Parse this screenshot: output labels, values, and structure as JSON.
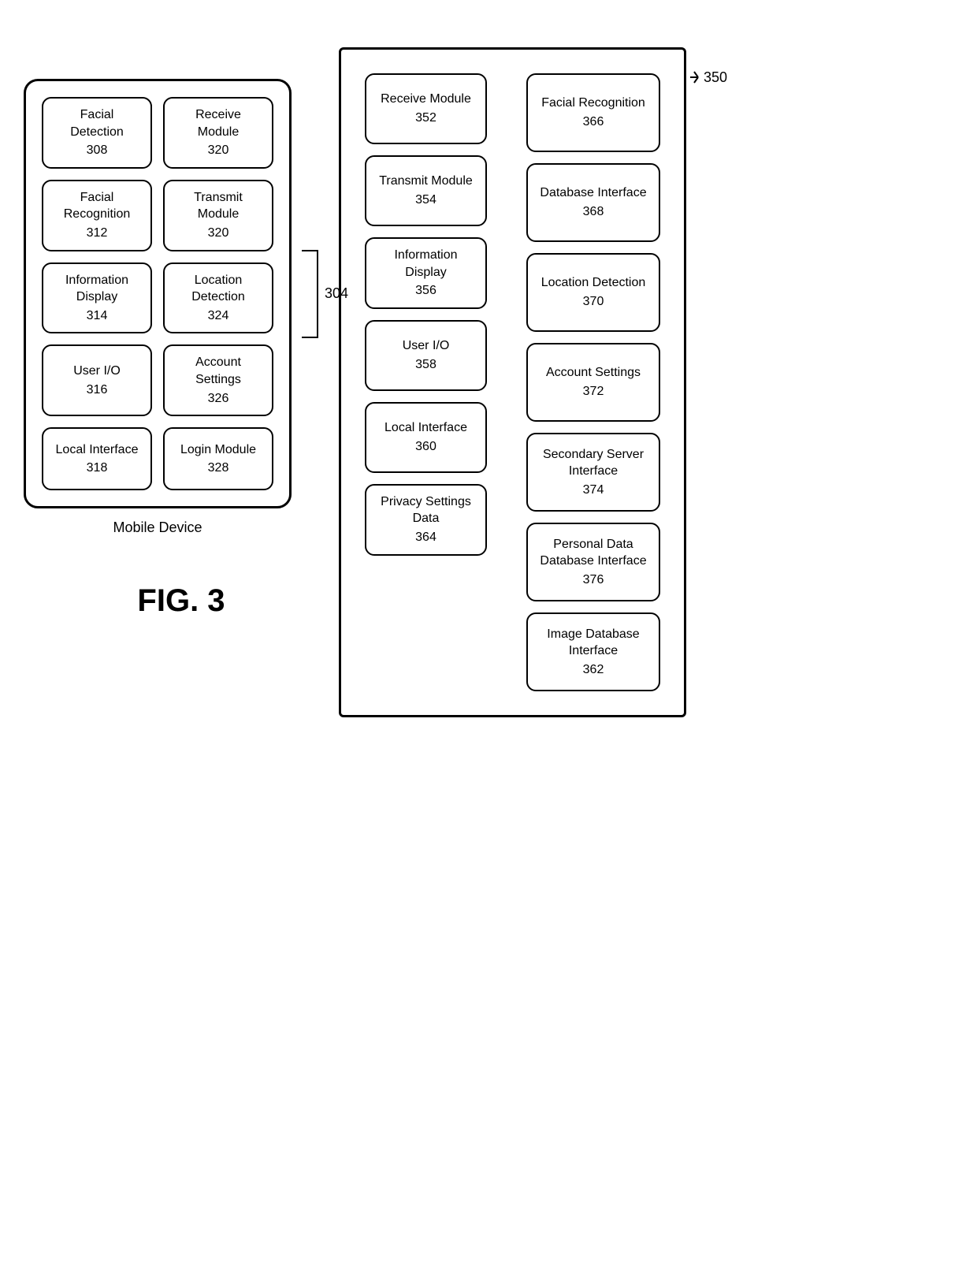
{
  "left": {
    "title": "Mobile Device",
    "box_label": "304",
    "fig": "FIG. 3",
    "modules": [
      {
        "name": "Facial Detection",
        "number": "308"
      },
      {
        "name": "Receive Module",
        "number": "320"
      },
      {
        "name": "Facial Recognition",
        "number": "312"
      },
      {
        "name": "Transmit Module",
        "number": "320"
      },
      {
        "name": "Information Display",
        "number": "314"
      },
      {
        "name": "Location Detection",
        "number": "324"
      },
      {
        "name": "User I/O",
        "number": "316"
      },
      {
        "name": "Account Settings",
        "number": "326"
      },
      {
        "name": "Local Interface",
        "number": "318"
      },
      {
        "name": "Login Module",
        "number": "328"
      }
    ]
  },
  "right": {
    "box_label": "350",
    "center_modules": [
      {
        "name": "Receive Module",
        "number": "352"
      },
      {
        "name": "Transmit Module",
        "number": "354"
      },
      {
        "name": "Information Display",
        "number": "356"
      },
      {
        "name": "User I/O",
        "number": "358"
      },
      {
        "name": "Local Interface",
        "number": "360"
      },
      {
        "name": "Privacy Settings Data",
        "number": "364"
      }
    ],
    "right_modules": [
      {
        "name": "Facial Recognition",
        "number": "366"
      },
      {
        "name": "Database Interface",
        "number": "368"
      },
      {
        "name": "Location Detection",
        "number": "370"
      },
      {
        "name": "Account Settings",
        "number": "372"
      },
      {
        "name": "Secondary Server Interface",
        "number": "374"
      },
      {
        "name": "Personal Data Database Interface",
        "number": "376"
      },
      {
        "name": "Image Database Interface",
        "number": "362"
      }
    ]
  }
}
